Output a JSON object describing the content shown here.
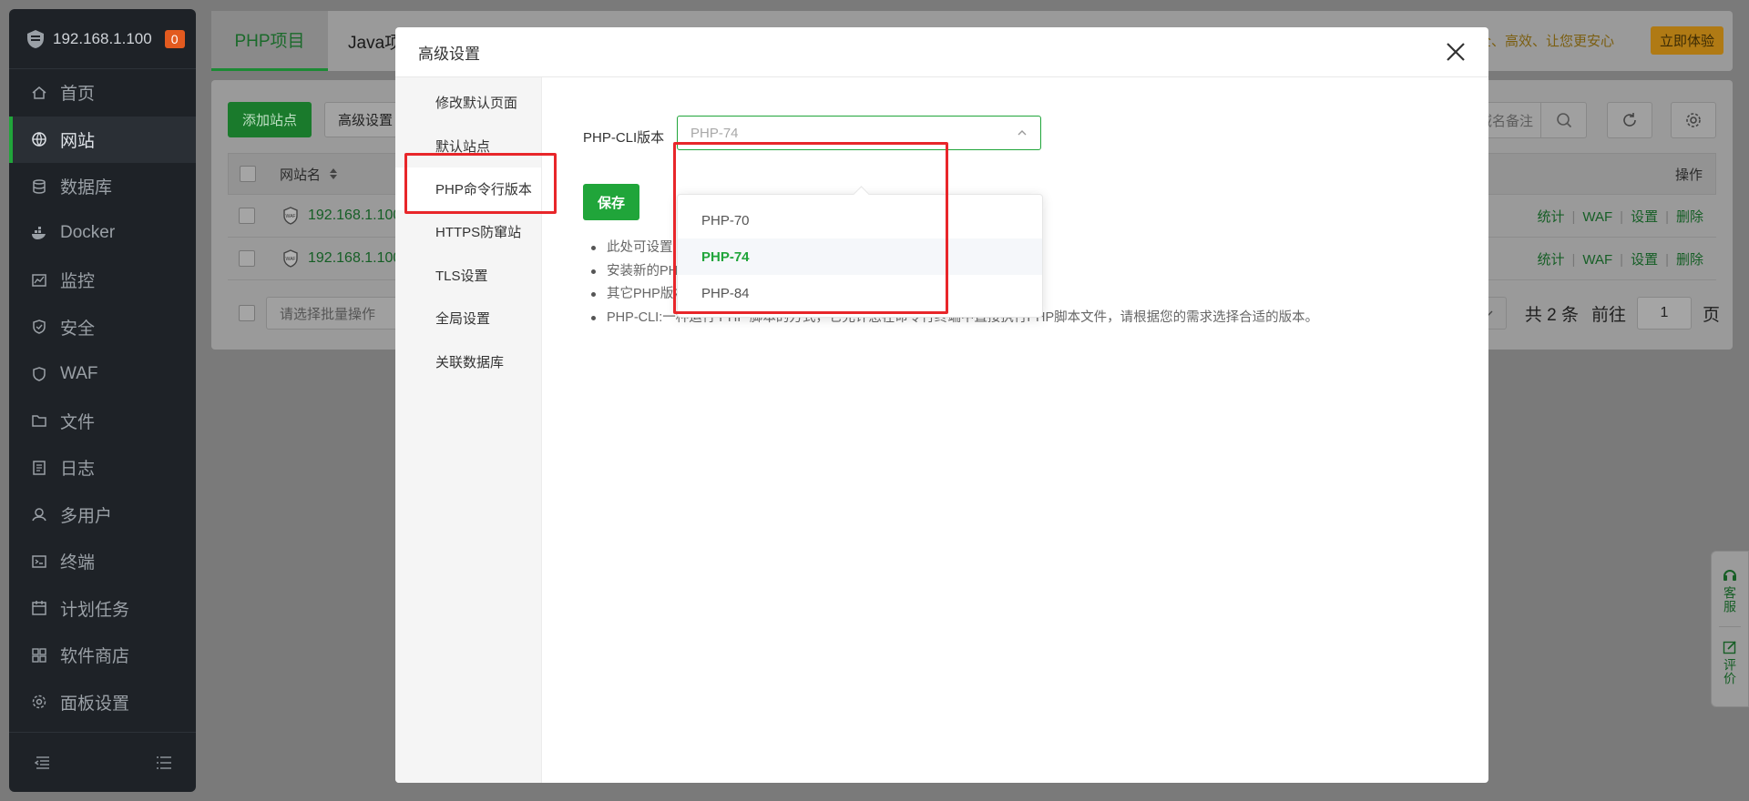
{
  "sidebar": {
    "ip": "192.168.1.100",
    "badge": "0",
    "items": [
      {
        "label": "首页",
        "icon": "home-icon"
      },
      {
        "label": "网站",
        "icon": "globe-icon"
      },
      {
        "label": "数据库",
        "icon": "database-icon"
      },
      {
        "label": "Docker",
        "icon": "docker-icon"
      },
      {
        "label": "监控",
        "icon": "monitor-icon"
      },
      {
        "label": "安全",
        "icon": "shield-icon"
      },
      {
        "label": "WAF",
        "icon": "waf-icon"
      },
      {
        "label": "文件",
        "icon": "folder-icon"
      },
      {
        "label": "日志",
        "icon": "log-icon"
      },
      {
        "label": "多用户",
        "icon": "users-icon"
      },
      {
        "label": "终端",
        "icon": "terminal-icon"
      },
      {
        "label": "计划任务",
        "icon": "calendar-icon"
      },
      {
        "label": "软件商店",
        "icon": "grid-icon"
      },
      {
        "label": "面板设置",
        "icon": "gear-icon"
      }
    ]
  },
  "topbar": {
    "tab_php": "PHP项目",
    "tab_java": "Java项",
    "promo": "安全、高效、让您更安心",
    "try_btn": "立即体验"
  },
  "panel": {
    "add_site": "添加站点",
    "advanced": "高级设置",
    "search_placeholder": "域名备注",
    "col_name": "网站名",
    "col_ops": "操作",
    "rows": [
      {
        "name": "192.168.1.100",
        "ops": [
          "统计",
          "WAF",
          "设置",
          "删除"
        ]
      },
      {
        "name": "192.168.1.100",
        "ops": [
          "统计",
          "WAF",
          "设置",
          "删除"
        ]
      }
    ],
    "batch_placeholder": "请选择批量操作",
    "total": "共 2 条",
    "goto": "前往",
    "page": "1",
    "page_unit": "页"
  },
  "float": {
    "service": "客服",
    "review": "评价"
  },
  "dialog": {
    "title": "高级设置",
    "menu": [
      "修改默认页面",
      "默认站点",
      "PHP命令行版本",
      "HTTPS防窜站",
      "TLS设置",
      "全局设置",
      "关联数据库"
    ],
    "cli_label": "PHP-CLI版本",
    "cli_value": "PHP-74",
    "save": "保存",
    "options": [
      "PHP-70",
      "PHP-74",
      "PHP-84"
    ],
    "notes": [
      "此处可设置",
      "安装新的PH",
      "其它PHP版本在命令行可通过php+版本的方式运行，如：php74,php80",
      "PHP-CLI:一种运行 PHP 脚本的方式，它允许您在命令行终端中直接执行PHP脚本文件，请根据您的需求选择合适的版本。"
    ]
  }
}
